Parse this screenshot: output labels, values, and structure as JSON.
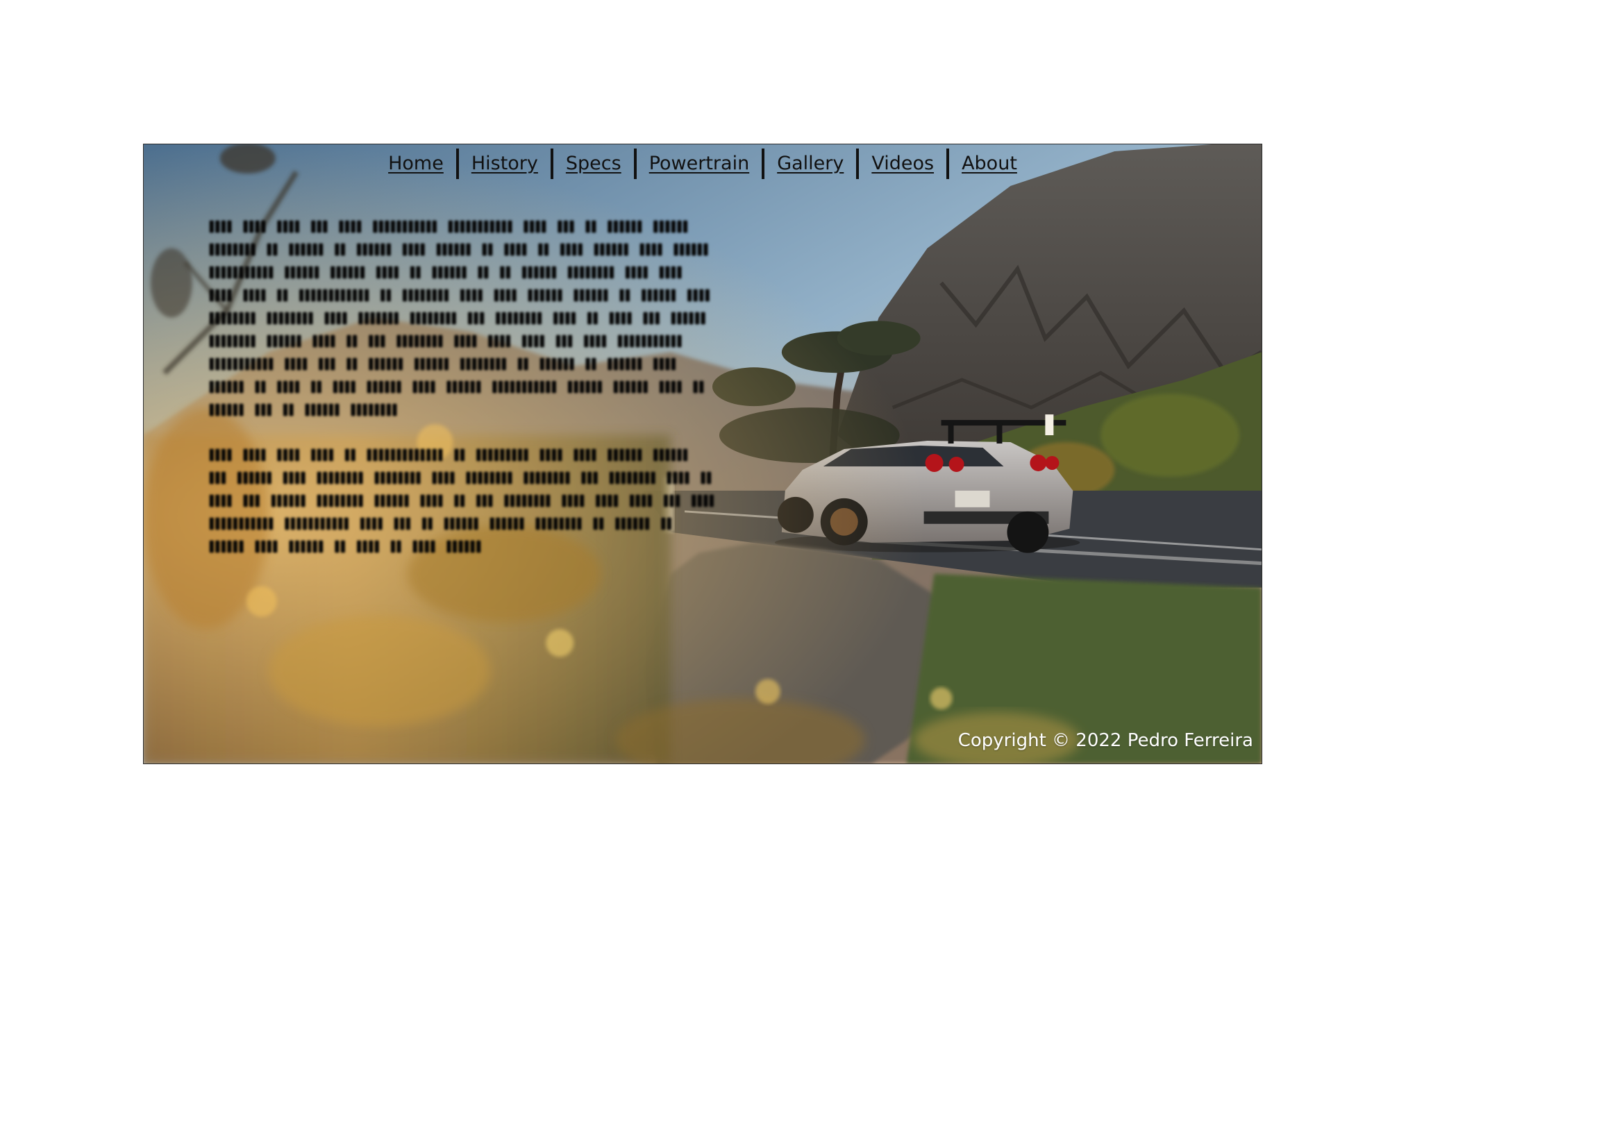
{
  "nav": {
    "items": [
      {
        "label": "Home"
      },
      {
        "label": "History"
      },
      {
        "label": "Specs"
      },
      {
        "label": "Powertrain"
      },
      {
        "label": "Gallery"
      },
      {
        "label": "Videos"
      },
      {
        "label": "About"
      }
    ]
  },
  "article": {
    "paragraphs": [
      "llll llll llll lll llll lllllllllll lllllllllll llll lll ll llllll llllll llllllll ll llllll ll llllll llll llllll ll llll ll llll llllll llll llllll lllllllllll llllll llllll llll ll llllll ll ll llllll llllllll llll llll llll llll ll llllllllllll ll llllllll llll llll llllll llllll ll llllll llll llllllll llllllll llll lllllll llllllll lll llllllll llll ll llll lll llllll llllllll llllll llll ll lll llllllll llll llll llll lll llll lllllllllll lllllllllll llll lll ll llllll llllll llllllll ll llllll ll llllll llll llllll ll llll ll llll llllll llll llllll lllllllllll llllll llllll llll ll llllll lll ll llllll llllllll",
      "llll llll llll llll ll lllllllllllll ll lllllllll llll llll llllll llllll lll llllll llll llllllll llllllll llll llllllll llllllll lll llllllll llll ll llll lll llllll llllllll llllll llll ll lll llllllll llll llll llll lll llll lllllllllll lllllllllll llll lll ll llllll llllll llllllll ll llllll ll llllll llll llllll ll llll ll llll llllll"
    ]
  },
  "footer": {
    "copyright": "Copyright © 2022 Pedro Ferreira"
  },
  "colors": {
    "nav_text": "#111111",
    "copyright_text": "#ffffff",
    "body_text": "#050505"
  }
}
